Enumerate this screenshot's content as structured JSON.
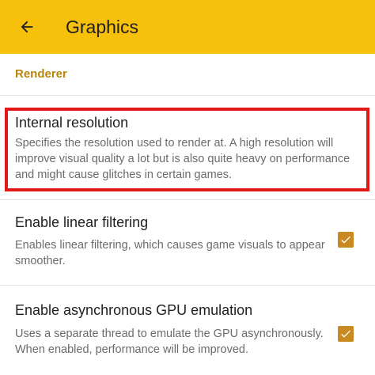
{
  "toolbar": {
    "title": "Graphics",
    "back_icon": "arrow-back-icon"
  },
  "colors": {
    "toolbar": "#f7c00a",
    "section_header": "#b8860b",
    "checkbox": "#c88a20",
    "highlight": "#e31818"
  },
  "section": {
    "header": "Renderer"
  },
  "preferences": [
    {
      "title": "Internal resolution",
      "summary": "Specifies the resolution used to render at. A high resolution will improve visual quality a lot but is also quite heavy on performance and might cause glitches in certain games.",
      "highlighted": true
    },
    {
      "title": "Enable linear filtering",
      "summary": "Enables linear filtering, which causes game visuals to appear smoother.",
      "checked": true,
      "icon": "checkbox-checked-icon"
    },
    {
      "title": "Enable asynchronous GPU emulation",
      "summary": "Uses a separate thread to emulate the GPU asynchronously. When enabled, performance will be improved.",
      "checked": true,
      "icon": "checkbox-checked-icon"
    }
  ]
}
